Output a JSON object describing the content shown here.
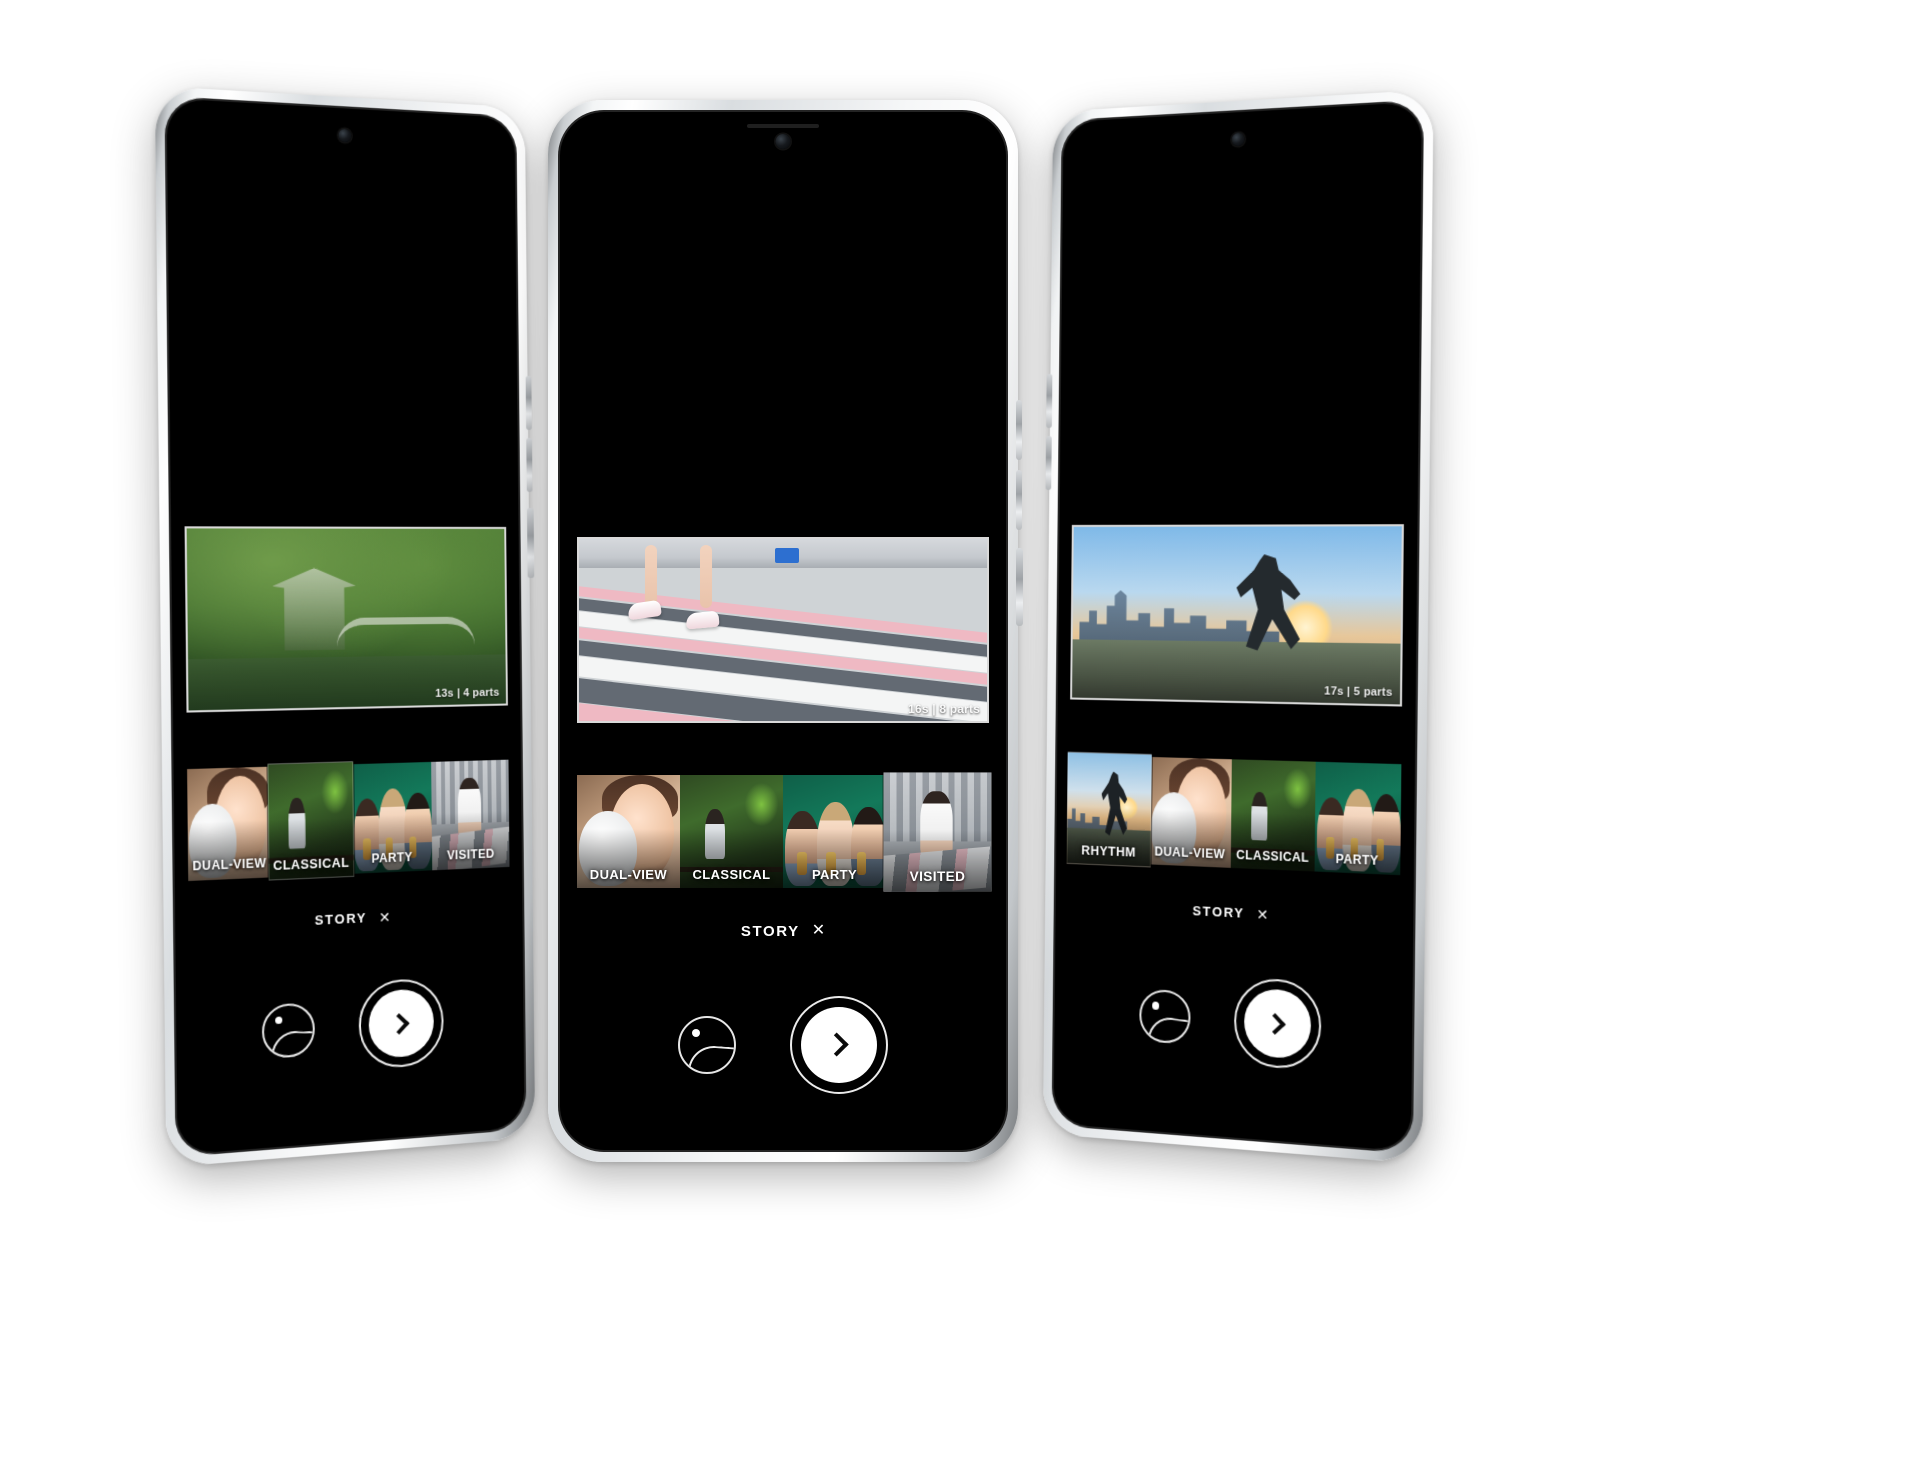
{
  "scene": {
    "background_color": "#ffffff",
    "device_count": 3
  },
  "phones": [
    {
      "id": "left",
      "preview": {
        "duration_label": "13s | 4 parts",
        "scene": "garden-pagoda"
      },
      "thumbnails": [
        {
          "label": "DUAL-VIEW",
          "selected": false,
          "art": "cat-selfie"
        },
        {
          "label": "CLASSICAL",
          "selected": true,
          "art": "cafe-classical"
        },
        {
          "label": "PARTY",
          "selected": false,
          "art": "party-friends"
        },
        {
          "label": "VISITED",
          "selected": false,
          "art": "street-visited"
        }
      ],
      "story": {
        "label": "STORY",
        "close_glyph": "✕"
      },
      "controls": {
        "gallery_icon": "gallery-icon",
        "shutter_icon": "chevron-right-icon"
      }
    },
    {
      "id": "center",
      "preview": {
        "duration_label": "16s | 8 parts",
        "scene": "crosswalk-feet"
      },
      "thumbnails": [
        {
          "label": "DUAL-VIEW",
          "selected": false,
          "art": "cat-selfie"
        },
        {
          "label": "CLASSICAL",
          "selected": false,
          "art": "cafe-classical"
        },
        {
          "label": "PARTY",
          "selected": false,
          "art": "party-friends"
        },
        {
          "label": "VISITED",
          "selected": true,
          "art": "street-visited"
        }
      ],
      "story": {
        "label": "STORY",
        "close_glyph": "✕"
      },
      "controls": {
        "gallery_icon": "gallery-icon",
        "shutter_icon": "chevron-right-icon"
      }
    },
    {
      "id": "right",
      "preview": {
        "duration_label": "17s | 5 parts",
        "scene": "skyline-runner"
      },
      "thumbnails": [
        {
          "label": "RHYTHM",
          "selected": true,
          "art": "skyline-runner"
        },
        {
          "label": "DUAL-VIEW",
          "selected": false,
          "art": "cat-selfie"
        },
        {
          "label": "CLASSICAL",
          "selected": false,
          "art": "cafe-classical"
        },
        {
          "label": "PARTY",
          "selected": false,
          "art": "party-friends"
        }
      ],
      "story": {
        "label": "STORY",
        "close_glyph": "✕"
      },
      "controls": {
        "gallery_icon": "gallery-icon",
        "shutter_icon": "chevron-right-icon"
      }
    }
  ],
  "colors": {
    "screen_background": "#000000",
    "accent_white": "#ffffff",
    "frame_silver": "#d9dde0"
  }
}
